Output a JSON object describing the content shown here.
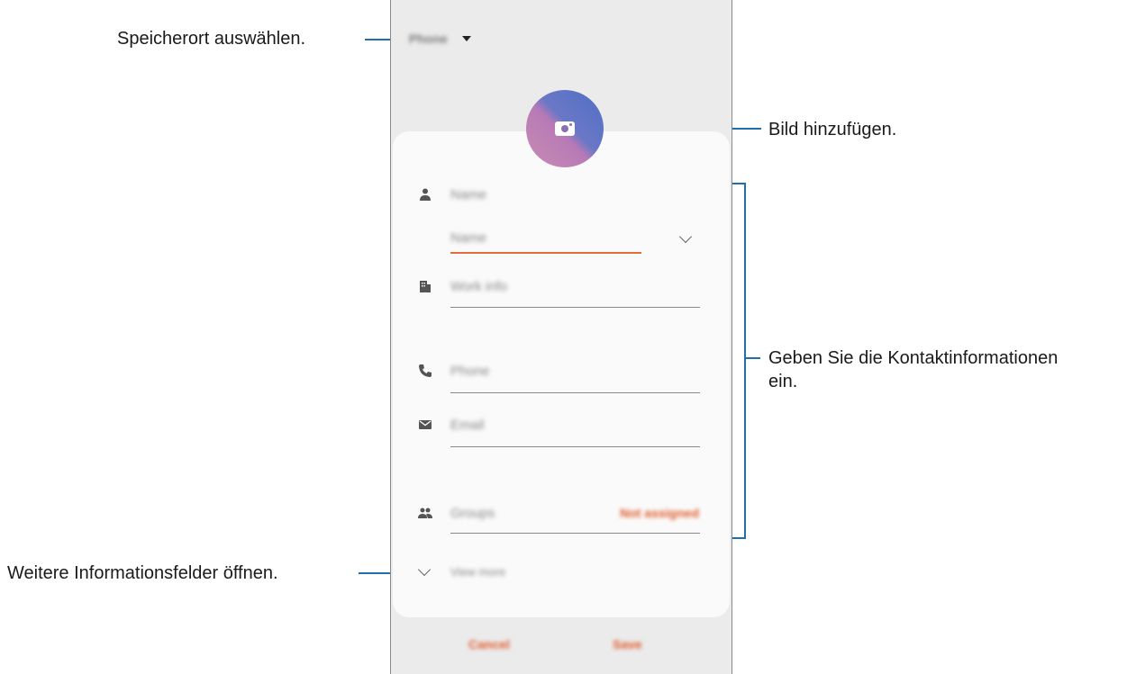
{
  "callouts": {
    "storage": "Speicherort auswählen.",
    "photo": "Bild hinzufügen.",
    "contact_info_line1": "Geben Sie die Kontaktinformationen",
    "contact_info_line2": "ein.",
    "more_fields": "Weitere Informationsfelder öffnen."
  },
  "screen": {
    "storage_location": "Phone",
    "fields": {
      "name_header": "Name",
      "name_input_placeholder": "Name",
      "work_info": "Work info",
      "phone": "Phone",
      "email": "Email",
      "groups": "Groups",
      "groups_value": "Not assigned",
      "view_more": "View more"
    },
    "buttons": {
      "cancel": "Cancel",
      "save": "Save"
    }
  },
  "colors": {
    "accent": "#e05a2c",
    "callout_line": "#1f6fae"
  }
}
